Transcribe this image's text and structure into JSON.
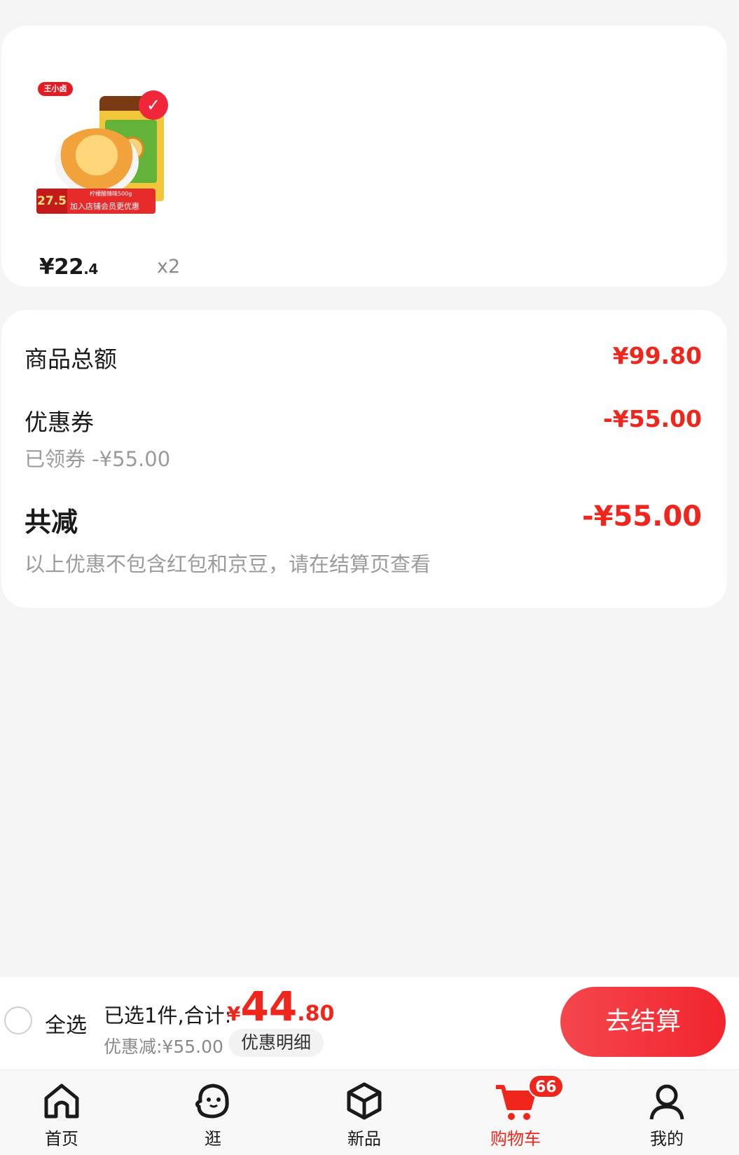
{
  "product": {
    "brand_logo": "王小卤",
    "promo_price": "27.5",
    "promo_text": "加入店铺会员更优惠",
    "promo_flavor": "柠檬酸辣味500g",
    "price_int": "¥22",
    "price_dec": ".4",
    "quantity": "x2",
    "selected": true
  },
  "summary": {
    "goods_total_label": "商品总额",
    "goods_total_value": "¥99.80",
    "coupon_label": "优惠券",
    "coupon_value": "-¥55.00",
    "coupon_sub": "已领券 -¥55.00",
    "total_reduce_label": "共减",
    "total_reduce_value": "-¥55.00",
    "note": "以上优惠不包含红包和京豆，请在结算页查看"
  },
  "checkout": {
    "select_all_label": "全选",
    "selected_text": "已选1件,合计:",
    "total_yen": "¥",
    "total_int": "44",
    "total_dec": ".80",
    "discount_text": "优惠减:¥55.00",
    "detail_label": "优惠明细",
    "checkout_label": "去结算"
  },
  "tabs": [
    {
      "label": "首页",
      "icon": "home-icon"
    },
    {
      "label": "逛",
      "icon": "browse-icon"
    },
    {
      "label": "新品",
      "icon": "new-products-icon"
    },
    {
      "label": "购物车",
      "icon": "cart-icon",
      "badge": "66",
      "active": true
    },
    {
      "label": "我的",
      "icon": "profile-icon"
    }
  ],
  "colors": {
    "accent": "#f0251c",
    "background": "#f5f5f6"
  }
}
